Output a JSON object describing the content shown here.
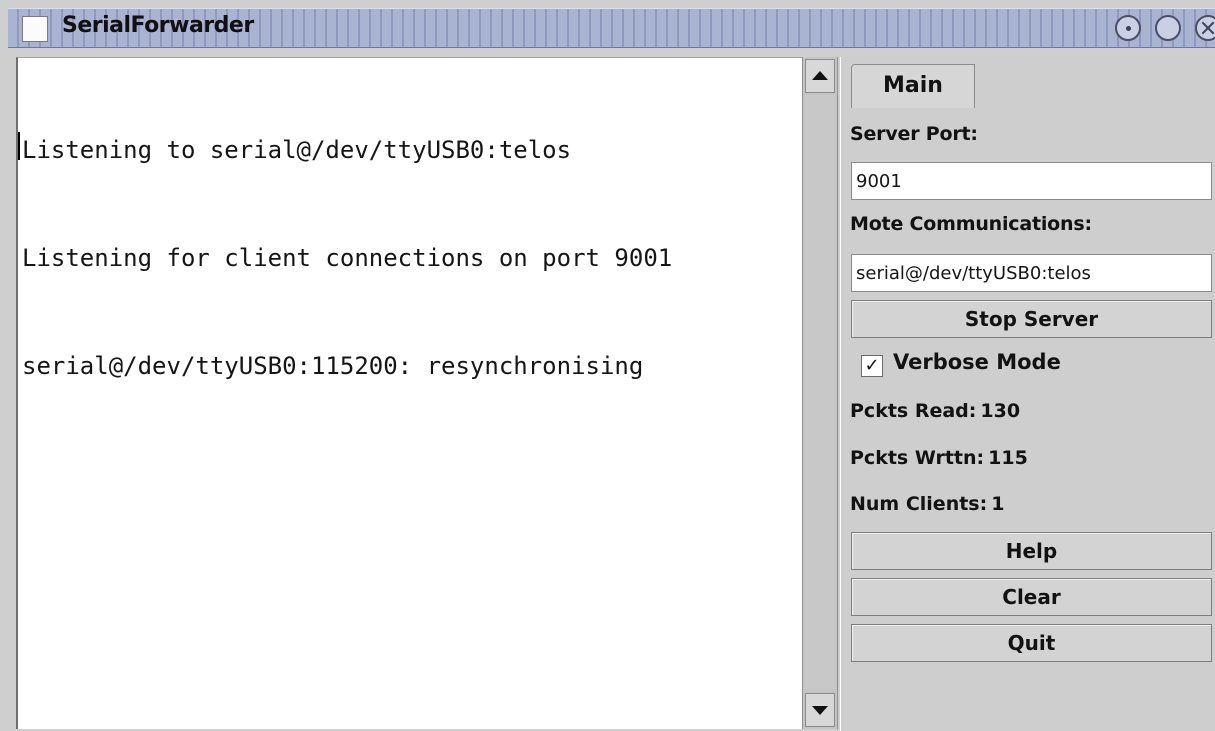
{
  "window": {
    "title": "SerialForwarder"
  },
  "log": {
    "lines": [
      "Listening to serial@/dev/ttyUSB0:telos",
      "Listening for client connections on port 9001",
      "serial@/dev/ttyUSB0:115200: resynchronising"
    ]
  },
  "panel": {
    "tab_label": "Main",
    "server_port_label": "Server Port:",
    "server_port_value": "9001",
    "mote_comm_label": "Mote Communications:",
    "mote_comm_value": "serial@/dev/ttyUSB0:telos",
    "stop_server_label": "Stop Server",
    "verbose_mode_label": "Verbose Mode",
    "verbose_mode_checked": true,
    "verbose_checkmark": "✓",
    "pckts_read_label": "Pckts Read:",
    "pckts_read_value": "130",
    "pckts_written_label": "Pckts Wrttn:",
    "pckts_written_value": "115",
    "num_clients_label": "Num Clients:",
    "num_clients_value": "1",
    "help_label": "Help",
    "clear_label": "Clear",
    "quit_label": "Quit"
  },
  "icons": {
    "window_icon": "document-icon",
    "minimize": "minimize-icon",
    "maximize": "maximize-icon",
    "close": "close-icon",
    "scroll_up": "arrow-up-icon",
    "scroll_down": "arrow-down-icon"
  },
  "colors": {
    "titlebar": "#a9b3d2",
    "panel_bg": "#cecece",
    "log_bg": "#ffffff"
  }
}
